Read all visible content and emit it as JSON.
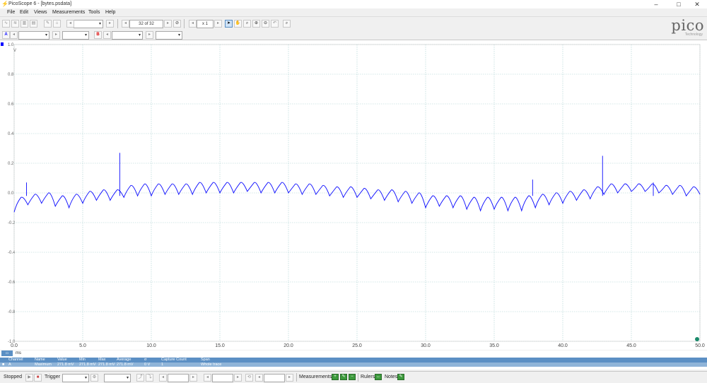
{
  "window": {
    "title": "PicoScope 6 - [bytes.psdata]",
    "minimize": "–",
    "maximize": "□",
    "close": "✕"
  },
  "menu": [
    "File",
    "Edit",
    "Views",
    "Measurements",
    "Tools",
    "Help"
  ],
  "toolbar": {
    "buffer_counter": "32 of 32",
    "zoom": "x 1",
    "channel_a": "A",
    "channel_b": "B"
  },
  "logo": {
    "word": "pico",
    "sub": "Technology"
  },
  "chart_data": {
    "type": "line",
    "title": "",
    "xlabel": "ms",
    "ylabel": "V",
    "xlim": [
      0,
      50
    ],
    "ylim": [
      -1.0,
      1.0
    ],
    "x_ticks": [
      "0.0",
      "5.0",
      "10.0",
      "15.0",
      "20.0",
      "25.0",
      "30.0",
      "35.0",
      "40.0",
      "45.0",
      "50.0"
    ],
    "y_ticks": [
      "1.0",
      "0.8",
      "0.6",
      "0.4",
      "0.2",
      "0.0",
      "-0.2",
      "-0.4",
      "-0.6",
      "-0.8",
      "-1.0"
    ],
    "grid": true,
    "series_color": "#0a0aff",
    "grid_color": "#a8d0d0",
    "series": [
      {
        "name": "A",
        "x": [
          0.0,
          0.5,
          1.0,
          1.5,
          2.0,
          2.5,
          3.0,
          3.5,
          4.0,
          4.5,
          5.0,
          5.5,
          6.0,
          6.5,
          7.0,
          7.5,
          8.0,
          8.5,
          9.0,
          9.5,
          10.0,
          10.5,
          11.0,
          11.5,
          12.0,
          12.5,
          13.0,
          13.5,
          14.0,
          14.5,
          15.0,
          15.5,
          16.0,
          16.5,
          17.0,
          17.5,
          18.0,
          18.5,
          19.0,
          19.5,
          20.0,
          20.5,
          21.0,
          21.5,
          22.0,
          22.5,
          23.0,
          23.5,
          24.0,
          24.5,
          25.0,
          25.5,
          26.0,
          26.5,
          27.0,
          27.5,
          28.0,
          28.5,
          29.0,
          29.5,
          30.0,
          30.5,
          31.0,
          31.5,
          32.0,
          32.5,
          33.0,
          33.5,
          34.0,
          34.5,
          35.0,
          35.5,
          36.0,
          36.5,
          37.0,
          37.5,
          38.0,
          38.5,
          39.0,
          39.5,
          40.0,
          40.5,
          41.0,
          41.5,
          42.0,
          42.5,
          43.0,
          43.5,
          44.0,
          44.5,
          45.0,
          45.5,
          46.0,
          46.5,
          47.0,
          47.5,
          48.0,
          48.5,
          49.0,
          49.5,
          50.0
        ],
        "y": [
          -0.13,
          -0.03,
          -0.08,
          -0.01,
          -0.07,
          0.0,
          -0.09,
          -0.02,
          -0.1,
          -0.01,
          -0.07,
          0.01,
          -0.05,
          0.02,
          -0.05,
          0.02,
          -0.03,
          0.05,
          -0.02,
          0.06,
          -0.02,
          0.06,
          -0.01,
          0.06,
          -0.01,
          0.06,
          -0.01,
          0.07,
          0.0,
          0.07,
          0.0,
          0.07,
          0.0,
          0.07,
          0.01,
          0.07,
          0.0,
          0.07,
          0.0,
          0.07,
          0.0,
          0.06,
          -0.01,
          0.06,
          -0.01,
          0.05,
          -0.02,
          0.04,
          -0.03,
          0.04,
          -0.03,
          0.03,
          -0.04,
          0.02,
          -0.05,
          0.02,
          -0.06,
          0.01,
          -0.07,
          0.0,
          -0.1,
          -0.02,
          -0.09,
          -0.02,
          -0.1,
          -0.02,
          -0.11,
          -0.03,
          -0.12,
          -0.03,
          -0.11,
          -0.03,
          -0.12,
          -0.03,
          -0.12,
          -0.02,
          -0.1,
          -0.01,
          -0.08,
          0.0,
          -0.07,
          0.01,
          -0.05,
          0.02,
          -0.04,
          0.04,
          -0.01,
          0.06,
          0.0,
          0.06,
          0.01,
          0.06,
          0.01,
          0.06,
          0.0,
          0.05,
          -0.01,
          0.05,
          -0.02,
          0.04,
          -0.01
        ]
      }
    ],
    "spikes": [
      {
        "x": 0.9,
        "y": 0.07
      },
      {
        "x": 7.7,
        "y": 0.27
      },
      {
        "x": 37.8,
        "y": 0.09
      },
      {
        "x": 42.9,
        "y": 0.25
      },
      {
        "x": 46.6,
        "y": 0.07
      }
    ]
  },
  "measurements": {
    "unit_tab": "ms",
    "headers": [
      "Channel",
      "Name",
      "Value",
      "Min",
      "Max",
      "Average",
      "σ",
      "Capture Count",
      "Span"
    ],
    "row": [
      "A",
      "Maximum",
      "271.8 mV",
      "271.8 mV",
      "271.8 mV",
      "271.8 mV",
      "0 V",
      "1",
      "Whole trace"
    ]
  },
  "status": {
    "stopped": "Stopped",
    "trigger": "Trigger",
    "measurements": "Measurements",
    "rulers": "Rulers",
    "notes": "Notes"
  }
}
